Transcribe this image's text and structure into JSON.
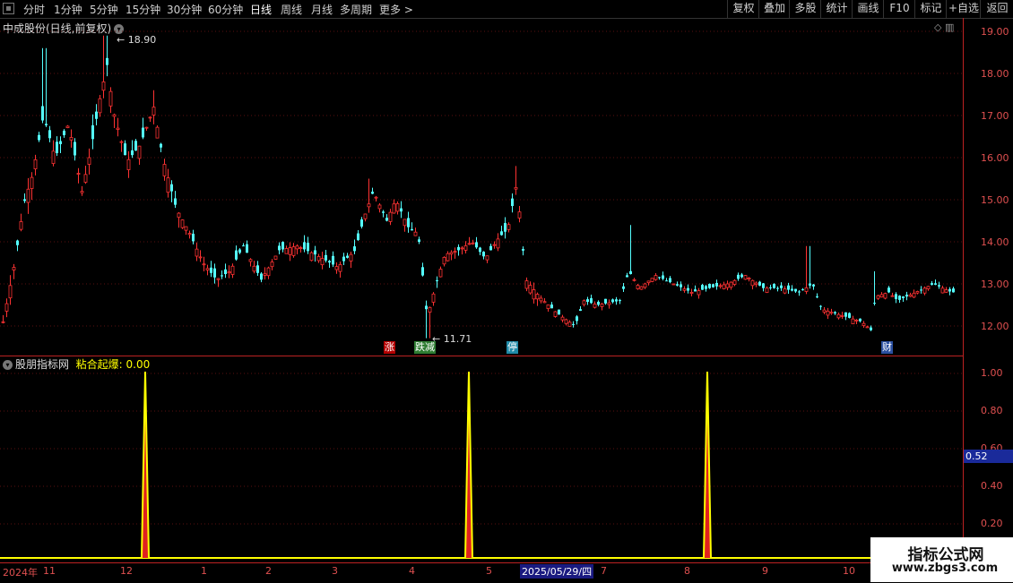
{
  "toolbar": {
    "left_items": [
      "分时",
      "1分钟",
      "5分钟",
      "15分钟",
      "30分钟",
      "60分钟",
      "日线",
      "周线",
      "月线",
      "多周期",
      "更多 >"
    ],
    "active": "日线",
    "right_items": [
      "复权",
      "叠加",
      "多股",
      "统计",
      "画线",
      "F10",
      "标记",
      "+自选",
      "返回"
    ]
  },
  "main": {
    "title": "中成股份(日线,前复权)",
    "high_label": "18.90",
    "low_label": "11.71",
    "price_ticks": [
      "19.00",
      "18.00",
      "17.00",
      "16.00",
      "15.00",
      "14.00",
      "13.00",
      "12.00"
    ],
    "events": [
      {
        "label": "涨",
        "bg": "#b40000",
        "fg": "#ffffff"
      },
      {
        "label": "跌减",
        "bg": "#2e7d32",
        "fg": "#ffffff"
      },
      {
        "label": "停",
        "bg": "#1f8aa8",
        "fg": "#ffffff"
      },
      {
        "label": "财",
        "bg": "#2a4fa0",
        "fg": "#ffffff"
      }
    ]
  },
  "indicator": {
    "name": "股朋指标网",
    "series_label": "粘合起爆: 0.00",
    "ticks": [
      "1.00",
      "0.80",
      "0.60",
      "0.40",
      "0.20"
    ],
    "current_value": "0.52"
  },
  "date_axis": {
    "labels": [
      "2024年",
      "11",
      "12",
      "1",
      "2",
      "3",
      "4",
      "5",
      "2025/05/29/四",
      "7",
      "8",
      "9",
      "10"
    ]
  },
  "watermark": {
    "line1": "指标公式网",
    "line2": "www.zbgs3.com"
  },
  "colors": {
    "up": "#ff3232",
    "down": "#54ffff",
    "spike": "#ffff00",
    "axis": "#b22222"
  },
  "chart_data": {
    "type": "candlestick",
    "ylim": [
      11.6,
      19.1
    ],
    "x_range_label": "2024年 – 2025/10",
    "indicator_spikes": [
      1.0,
      1.0,
      1.0
    ],
    "indicator_ylim": [
      0,
      1.05
    ]
  }
}
